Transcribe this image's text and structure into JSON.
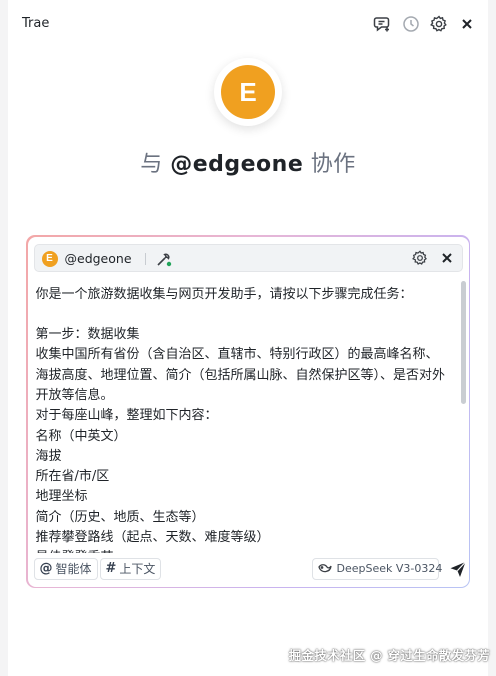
{
  "app": {
    "title": "Trae"
  },
  "titlebar_icons": [
    "new-chat-icon",
    "history-icon",
    "gear-icon",
    "close-icon"
  ],
  "hero": {
    "avatar_letter": "E",
    "heading_prefix": "与",
    "heading_mention": "@edgeone",
    "heading_suffix": "协作"
  },
  "agent": {
    "avatar_letter": "E",
    "name": "@edgeone"
  },
  "prompt": {
    "lines": [
      "你是一个旅游数据收集与网页开发助手，请按以下步骤完成任务：",
      "",
      "第一步：数据收集",
      "收集中国所有省份（含自治区、直辖市、特别行政区）的最高峰名称、海拔高度、地理位置、简介（包括所属山脉、自然保护区等）、是否对外开放等信息。",
      "对于每座山峰，整理如下内容：",
      "名称（中英文）",
      "海拔",
      "所在省/市/区",
      "地理坐标",
      "简介（历史、地质、生态等）",
      "推荐攀登路线（起点、天数、难度等级）",
      "最佳登登季节"
    ]
  },
  "footer": {
    "agent_chip": "智能体",
    "context_chip": "上下文",
    "model": "DeepSeek V3-0324"
  },
  "watermark": "掘金技术社区 @ 穿过生命散发芬芳",
  "colors": {
    "avatar": "#f0a020",
    "accent_border": "#c9b3ef",
    "send": "#1f2328"
  }
}
